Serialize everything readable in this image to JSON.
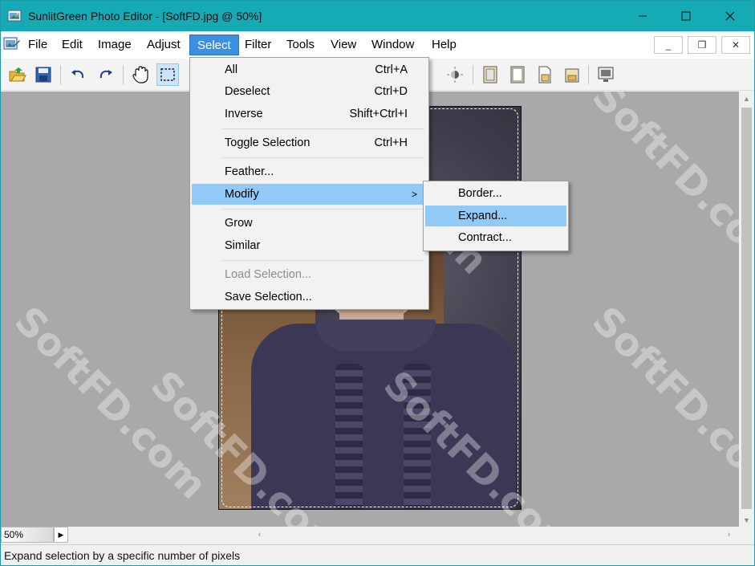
{
  "window": {
    "title": "SunlitGreen Photo Editor - [SoftFD.jpg @ 50%]",
    "controls": {
      "minimize": "—",
      "maximize": "☐",
      "close": "✕"
    }
  },
  "menubar": {
    "items": [
      "File",
      "Edit",
      "Image",
      "Adjust",
      "Select",
      "Filter",
      "Tools",
      "View",
      "Window",
      "Help"
    ],
    "active": "Select",
    "mdi_controls": {
      "minimize": "_",
      "restore": "❐",
      "close": "✕"
    }
  },
  "toolbar": {
    "tools": [
      "open-icon",
      "save-icon",
      "undo-icon",
      "redo-icon",
      "hand-icon",
      "rect-select-icon",
      "rotate-icon",
      "brightness-icon",
      "border-frame-icon",
      "canvas-size-icon",
      "resize-icon",
      "crop-icon",
      "fullscreen-icon"
    ]
  },
  "select_menu": {
    "items": [
      {
        "label": "All",
        "shortcut": "Ctrl+A"
      },
      {
        "label": "Deselect",
        "shortcut": "Ctrl+D"
      },
      {
        "label": "Inverse",
        "shortcut": "Shift+Ctrl+I"
      },
      {
        "label": "Toggle Selection",
        "shortcut": "Ctrl+H"
      },
      {
        "label": "Feather...",
        "shortcut": ""
      },
      {
        "label": "Modify",
        "shortcut": "",
        "submenu_arrow": ">"
      },
      {
        "label": "Grow",
        "shortcut": ""
      },
      {
        "label": "Similar",
        "shortcut": ""
      },
      {
        "label": "Load Selection...",
        "shortcut": "",
        "disabled": true
      },
      {
        "label": "Save Selection...",
        "shortcut": ""
      }
    ],
    "highlighted": "Modify"
  },
  "modify_submenu": {
    "items": [
      "Border...",
      "Expand...",
      "Contract..."
    ],
    "highlighted": "Expand..."
  },
  "canvas": {
    "watermark_text": "SoftFD.com",
    "zoom": "50%"
  },
  "statusbar": {
    "text": "Expand selection by a specific number of pixels"
  },
  "colors": {
    "titlebar": "#16aab5",
    "menu_active": "#3d8fe0",
    "menu_highlight": "#91c9f7",
    "canvas_bg": "#a9a9a9"
  }
}
